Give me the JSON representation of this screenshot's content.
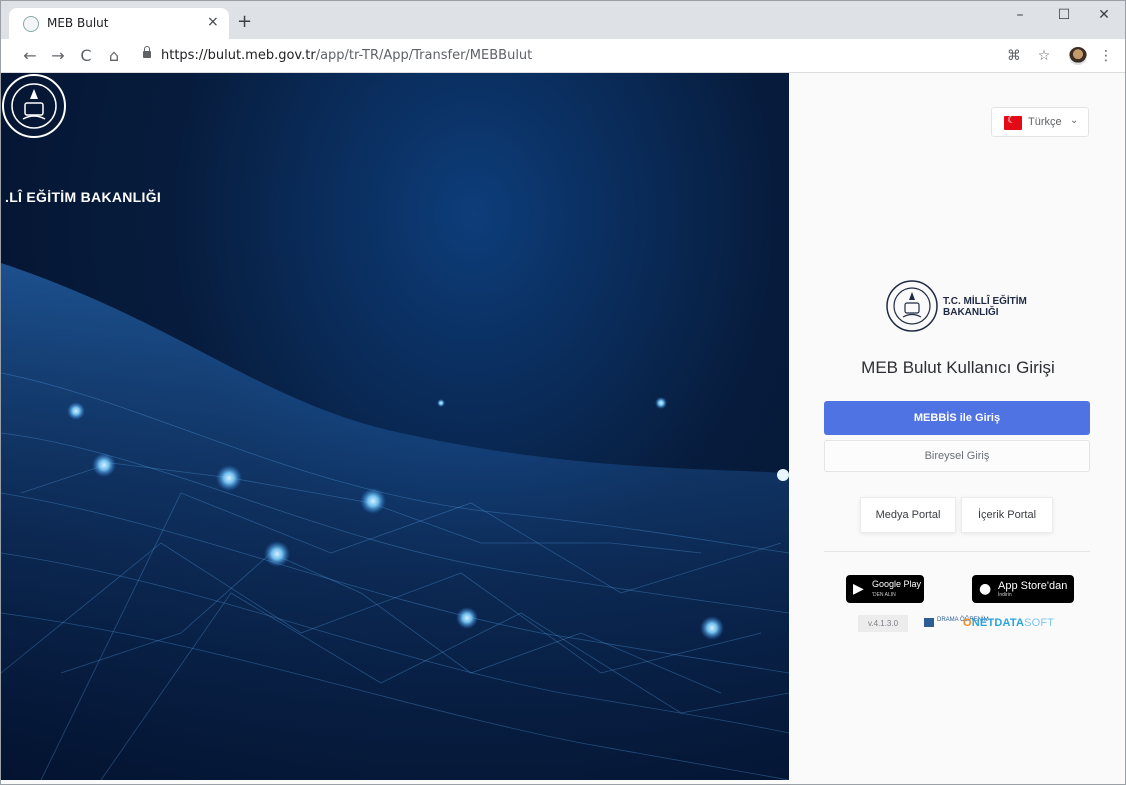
{
  "browser": {
    "tab_title": "MEB Bulut",
    "tab_close": "×",
    "new_tab": "+",
    "url_host": "https://bulut.meb.gov.tr",
    "url_path": "/app/tr-TR/App/Transfer/MEBBulut",
    "window_controls": {
      "minimize": "–",
      "maximize": "☐",
      "close": "✕"
    },
    "nav": {
      "back": "←",
      "forward": "→",
      "reload": "C",
      "home": "⌂"
    },
    "toolbar_icons": {
      "translate": "⌘",
      "bookmark": "☆",
      "menu": "⋮"
    }
  },
  "hero": {
    "ministry_text": ".LÎ EĞİTİM BAKANLIĞI"
  },
  "panel": {
    "language": {
      "label": "Türkçe",
      "chevron": "⌄"
    },
    "ministry_logo_text_line1": "T.C. MİLLÎ EĞİTİM",
    "ministry_logo_text_line2": "BAKANLIĞI",
    "login_title": "MEB Bulut Kullanıcı Girişi",
    "btn_mebbis": "MEBBİS ile Giriş",
    "btn_bireysel": "Bireysel Giriş",
    "btn_medya": "Medya Portal",
    "btn_icerik": "İçerik Portal",
    "google_play_line1": "Google Play",
    "google_play_line2": "'DEN ALIN",
    "app_store_line1": "App Store'dan",
    "app_store_line2": "İndirin",
    "version": "v.4.1.3.0",
    "partner1": "DRAMA ÖĞRENİM",
    "partner2_a": "O",
    "partner2_b": "NETDATA",
    "partner2_c": "SOFT"
  },
  "colors": {
    "primary_button": "#5073e3",
    "hero_dark": "#03102a",
    "hero_accent": "#5fb8ff"
  }
}
